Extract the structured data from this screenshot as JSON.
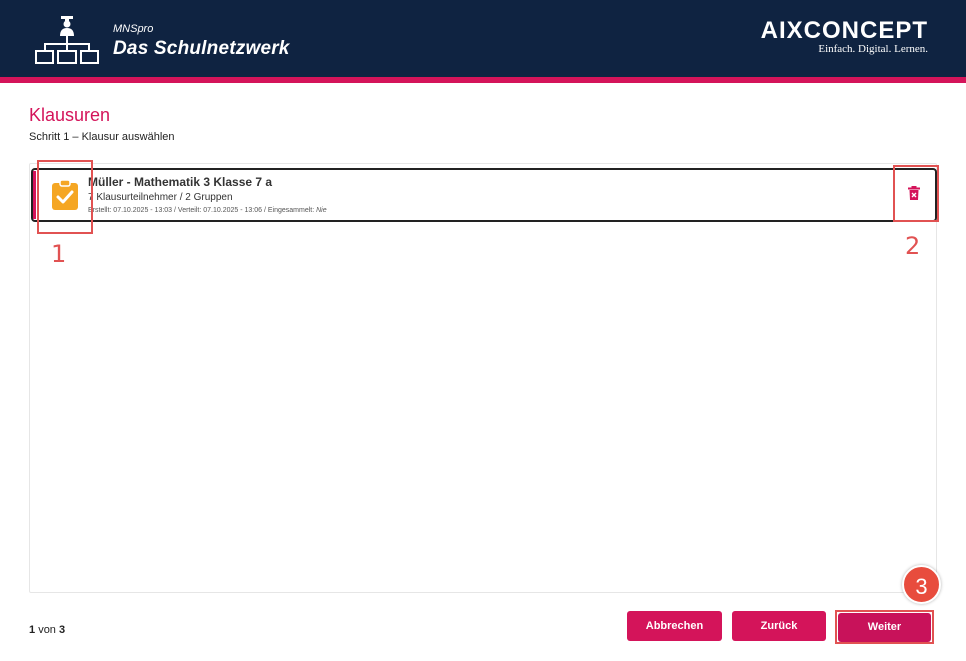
{
  "header": {
    "brand_small": "MNSpro",
    "brand_big": "Das Schulnetzwerk",
    "vendor_name": "AIXCONCEPT",
    "vendor_tagline": "Einfach. Digital. Lernen.",
    "background_color": "#0f2341",
    "accent_color": "#d4145a"
  },
  "page": {
    "title": "Klausuren",
    "subtitle": "Schritt 1 – Klausur auswählen"
  },
  "exam_list": [
    {
      "icon": "clipboard-check-icon",
      "title": "Müller - Mathematik 3 Klasse 7 a",
      "participants": "7 Klausurteilnehmer / 2 Gruppen",
      "created_label": "Erstellt:",
      "created_value": "07.10.2025 - 13:03",
      "distributed_label": "Verteilt:",
      "distributed_value": "07.10.2025 - 13:06",
      "collected_label": "Eingesammelt:",
      "collected_value": "Nie",
      "sep": " / "
    }
  ],
  "annotations": {
    "n1": "1",
    "n2": "2",
    "n3": "3"
  },
  "pager": {
    "current": "1",
    "of": "von",
    "total": "3"
  },
  "buttons": {
    "cancel": "Abbrechen",
    "back": "Zurück",
    "next": "Weiter"
  }
}
